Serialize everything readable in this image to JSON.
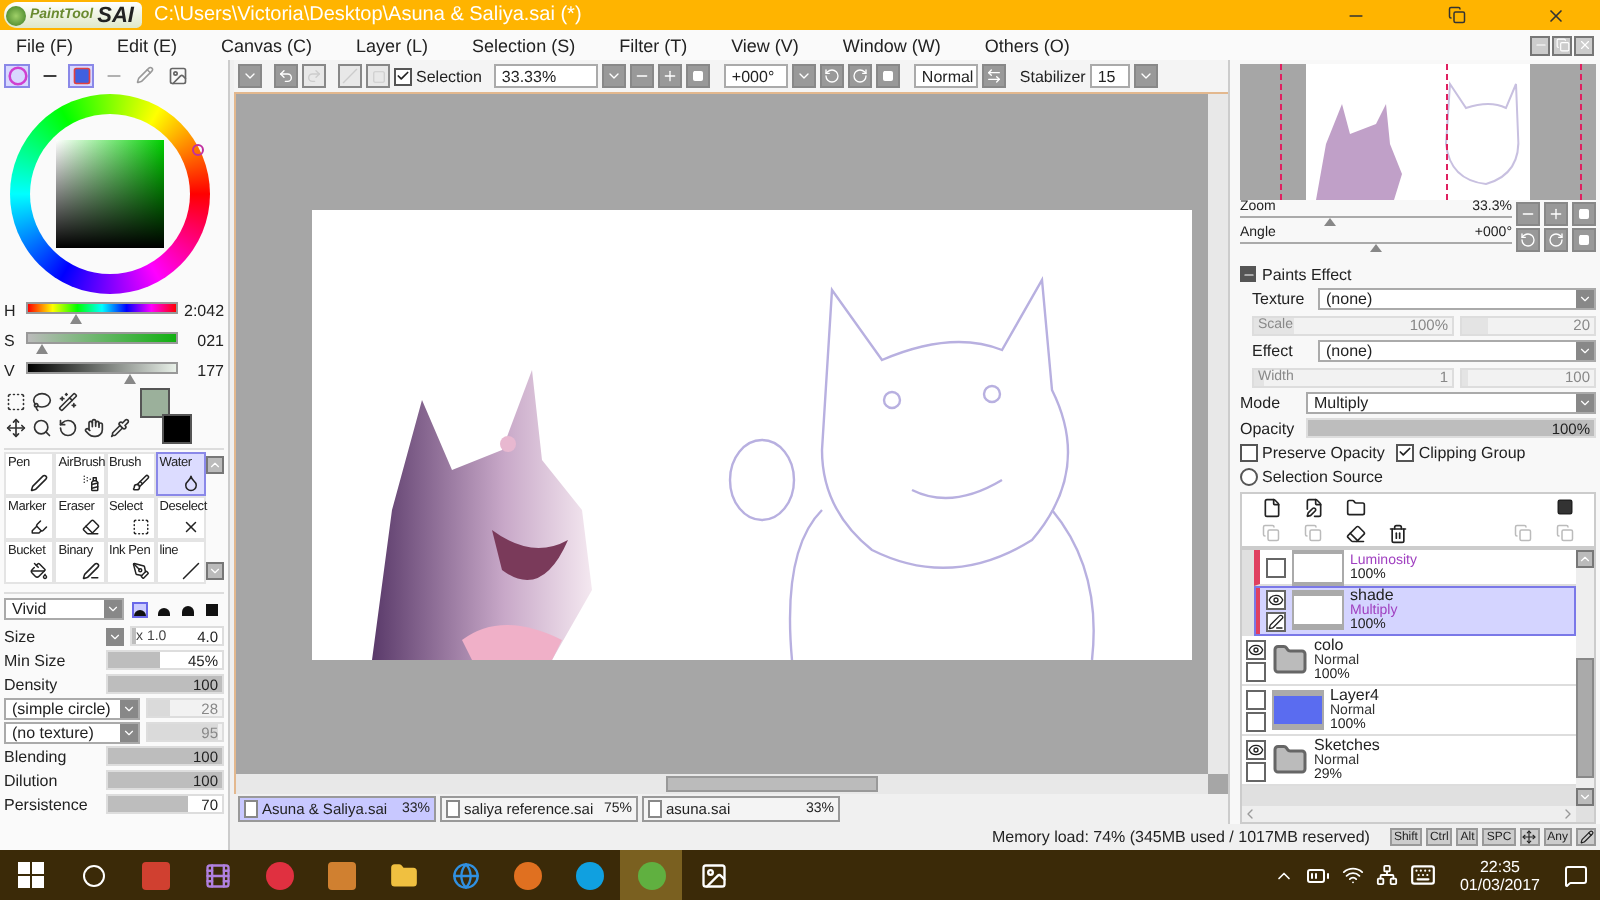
{
  "window": {
    "logo_small": "PaintTool",
    "logo_big": "SAI",
    "title": "C:\\Users\\Victoria\\Desktop\\Asuna & Saliya.sai (*)"
  },
  "menu": [
    "File (F)",
    "Edit (E)",
    "Canvas (C)",
    "Layer (L)",
    "Selection (S)",
    "Filter (T)",
    "View (V)",
    "Window (W)",
    "Others (O)"
  ],
  "toolbar": {
    "selection": {
      "label": "Selection",
      "checked": true
    },
    "zoom": "33.33%",
    "angle": "+000°",
    "blend_mode": "Normal",
    "stabilizer_label": "Stabilizer",
    "stabilizer": "15"
  },
  "color_modes": [
    {
      "selected": true
    },
    {
      "selected": false
    },
    {
      "selected": true
    },
    {
      "selected": false
    },
    {
      "selected": false
    },
    {
      "selected": false
    }
  ],
  "hsv": [
    {
      "label": "H",
      "value": "2:042",
      "level": 0.33
    },
    {
      "label": "S",
      "value": "021",
      "level": 0.1
    },
    {
      "label": "V",
      "value": "177",
      "level": 0.69
    }
  ],
  "tools": [
    {
      "name": "Pen",
      "selected": false
    },
    {
      "name": "AirBrush",
      "selected": false
    },
    {
      "name": "Brush",
      "selected": false
    },
    {
      "name": "Water",
      "selected": true
    },
    {
      "name": "Marker",
      "selected": false
    },
    {
      "name": "Eraser",
      "selected": false
    },
    {
      "name": "Select",
      "selected": false
    },
    {
      "name": "Deselect",
      "selected": false
    },
    {
      "name": "Bucket",
      "selected": false
    },
    {
      "name": "Binary",
      "selected": false
    },
    {
      "name": "Ink Pen",
      "selected": false
    },
    {
      "name": "line",
      "selected": false
    }
  ],
  "brush": {
    "mode": "Vivid",
    "shapes": [
      {
        "selected": true
      },
      {
        "selected": false
      },
      {
        "selected": false
      },
      {
        "selected": false
      }
    ],
    "size": {
      "label": "Size",
      "multiplier": "x 1.0",
      "value": "4.0",
      "level": 0.04
    },
    "sliders": [
      {
        "kind": "slider",
        "label": "Min Size",
        "value": "45%",
        "level": 0.45
      },
      {
        "kind": "slider",
        "label": "Density",
        "value": "100",
        "level": 1
      },
      {
        "kind": "dropdown",
        "label": "(simple circle)",
        "value": "28",
        "level": 0.3
      },
      {
        "kind": "dropdown",
        "label": "(no texture)",
        "value": "95",
        "level": 0.95
      },
      {
        "kind": "slider",
        "label": "Blending",
        "value": "100",
        "level": 1
      },
      {
        "kind": "slider",
        "label": "Dilution",
        "value": "100",
        "level": 1
      },
      {
        "kind": "slider",
        "label": "Persistence",
        "value": "70",
        "level": 0.7
      }
    ]
  },
  "navigator": [
    {
      "label": "Zoom",
      "value": "33.3%",
      "level": 0.33
    },
    {
      "label": "Angle",
      "value": "+000°",
      "level": 0.5
    }
  ],
  "paints_effect": {
    "title": "Paints Effect",
    "texture_label": "Texture",
    "texture": "(none)",
    "effect_label": "Effect",
    "effect": "(none)",
    "scale": [
      {
        "label": "Scale",
        "value": "100%",
        "level": 0.2
      },
      {
        "value": "20",
        "level": 0.2
      }
    ],
    "width": [
      {
        "label": "Width",
        "value": "1",
        "level": 0.05
      },
      {
        "value": "100",
        "level": 0.05
      }
    ]
  },
  "layer_props": {
    "mode_label": "Mode",
    "mode": "Multiply",
    "opacity_label": "Opacity",
    "opacity": {
      "value": "100%",
      "level": 1
    },
    "options": [
      {
        "label": "Preserve Opacity",
        "checked": false
      },
      {
        "label": "Clipping Group",
        "checked": true
      }
    ],
    "selection_source": {
      "label": "Selection Source",
      "selected": false
    }
  },
  "layers": [
    {
      "kind": "layer",
      "mode": "Luminosity",
      "opacity": "100%",
      "visible": false,
      "clipped": true,
      "selected": false,
      "color": "#ffffff"
    },
    {
      "kind": "layer",
      "name": "shade",
      "mode": "Multiply",
      "opacity": "100%",
      "visible": true,
      "clipped": true,
      "selected": true,
      "color": "#ffffff"
    },
    {
      "kind": "folder",
      "name": "colo",
      "mode": "Normal",
      "opacity": "100%",
      "visible": true,
      "clipped": false,
      "selected": false
    },
    {
      "kind": "layer",
      "name": "Layer4",
      "mode": "Normal",
      "opacity": "100%",
      "visible": false,
      "clipped": false,
      "selected": false,
      "color": "#5a6cf0"
    },
    {
      "kind": "folder",
      "name": "Sketches",
      "mode": "Normal",
      "opacity": "29%",
      "visible": true,
      "clipped": false,
      "selected": false
    }
  ],
  "documents": [
    {
      "name": "Asuna & Saliya.sai",
      "zoom": "33%",
      "selected": true
    },
    {
      "name": "saliya reference.sai",
      "zoom": "75%",
      "selected": false
    },
    {
      "name": "asuna.sai",
      "zoom": "33%",
      "selected": false
    }
  ],
  "status": {
    "memory": "Memory load: 74% (345MB used / 1017MB reserved)",
    "keys": [
      "Shift",
      "Ctrl",
      "Alt",
      "SPC",
      "Any"
    ]
  },
  "taskbar": {
    "time": "22:35",
    "date": "01/03/2017"
  }
}
